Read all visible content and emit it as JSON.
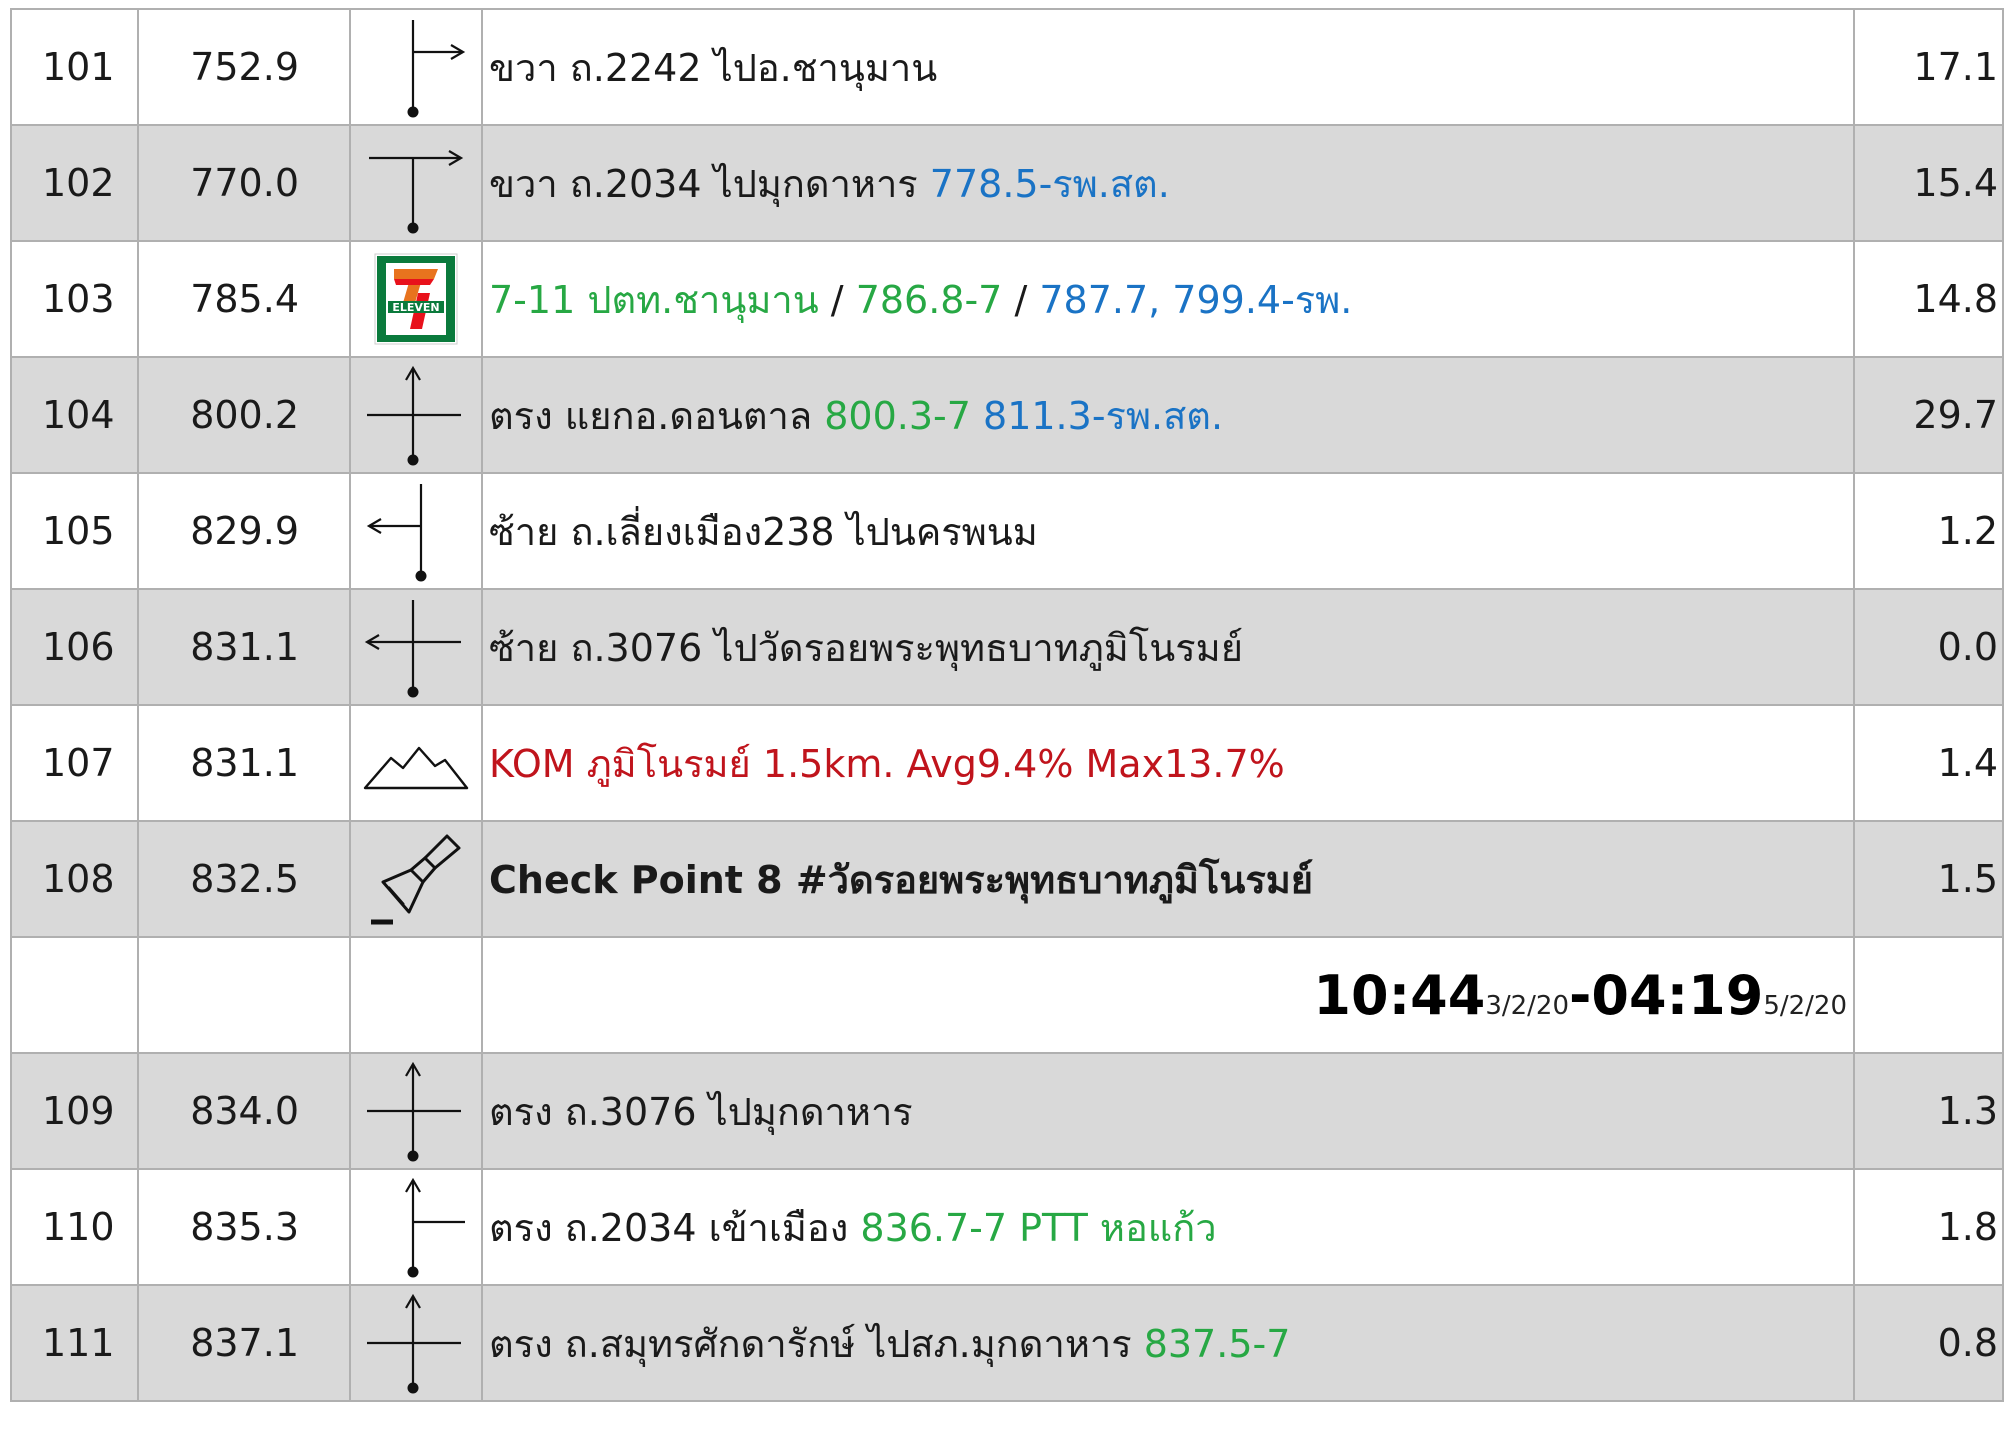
{
  "rows": [
    {
      "no": "101",
      "km": "752.9",
      "icon": "turn-right-icon",
      "segments": [
        {
          "t": "ขวา ถ.2242 ไปอ.ชานุมาน",
          "c": ""
        }
      ],
      "dist": "17.1",
      "gray": false
    },
    {
      "no": "102",
      "km": "770.0",
      "icon": "t-junction-right-icon",
      "segments": [
        {
          "t": "ขวา ถ.2034 ไปมุกดาหาร ",
          "c": ""
        },
        {
          "t": "778.5-รพ.สต.",
          "c": "blue"
        }
      ],
      "dist": "15.4",
      "gray": true
    },
    {
      "no": "103",
      "km": "785.4",
      "icon": "seven-eleven-logo",
      "segments": [
        {
          "t": "7-11 ปตท.ชานุมาน",
          "c": "green"
        },
        {
          "t": " / ",
          "c": ""
        },
        {
          "t": "786.8-7",
          "c": "green"
        },
        {
          "t": " / ",
          "c": ""
        },
        {
          "t": "787.7, 799.4-รพ.",
          "c": "blue"
        }
      ],
      "dist": "14.8",
      "gray": false
    },
    {
      "no": "104",
      "km": "800.2",
      "icon": "crossroad-straight-icon",
      "segments": [
        {
          "t": "ตรง แยกอ.ดอนตาล ",
          "c": ""
        },
        {
          "t": "800.3-7",
          "c": "green"
        },
        {
          "t": " ",
          "c": ""
        },
        {
          "t": "811.3-รพ.สต.",
          "c": "blue"
        }
      ],
      "dist": "29.7",
      "gray": true
    },
    {
      "no": "105",
      "km": "829.9",
      "icon": "turn-left-icon",
      "segments": [
        {
          "t": "ซ้าย ถ.เลี่ยงเมือง238 ไปนครพนม",
          "c": ""
        }
      ],
      "dist": "1.2",
      "gray": false
    },
    {
      "no": "106",
      "km": "831.1",
      "icon": "crossroad-left-icon",
      "segments": [
        {
          "t": "ซ้าย ถ.3076 ไปวัดรอยพระพุทธบาทภูมิโนรมย์",
          "c": ""
        }
      ],
      "dist": "0.0",
      "gray": true
    },
    {
      "no": "107",
      "km": "831.1",
      "icon": "mountain-icon",
      "segments": [
        {
          "t": "KOM ภูมิโนรมย์ 1.5km. Avg9.4% Max13.7%",
          "c": "red"
        }
      ],
      "dist": "1.4",
      "gray": false
    },
    {
      "no": "108",
      "km": "832.5",
      "icon": "stamp-icon",
      "segments": [
        {
          "t": "Check Point 8 #วัดรอยพระพุทธบาทภูมิโนรมย์",
          "c": "bold"
        }
      ],
      "dist": "1.5",
      "gray": true
    },
    {
      "no": "",
      "km": "",
      "icon": "",
      "time": {
        "open": "10:44",
        "open_date": "3/2/20",
        "close": "04:19",
        "close_date": "5/2/20"
      },
      "dist": "",
      "gray": false
    },
    {
      "no": "109",
      "km": "834.0",
      "icon": "crossroad-straight-icon",
      "segments": [
        {
          "t": "ตรง ถ.3076 ไปมุกดาหาร",
          "c": ""
        }
      ],
      "dist": "1.3",
      "gray": true
    },
    {
      "no": "110",
      "km": "835.3",
      "icon": "fork-straight-right-icon",
      "segments": [
        {
          "t": "ตรง ถ.2034 เข้าเมือง ",
          "c": ""
        },
        {
          "t": "836.7-7 PTT หอแก้ว",
          "c": "green"
        }
      ],
      "dist": "1.8",
      "gray": false
    },
    {
      "no": "111",
      "km": "837.1",
      "icon": "crossroad-straight-icon",
      "segments": [
        {
          "t": "ตรง ถ.สมุทรศักดารักษ์ ไปสภ.มุกดาหาร ",
          "c": ""
        },
        {
          "t": "837.5-7",
          "c": "green"
        }
      ],
      "dist": "0.8",
      "gray": true
    }
  ],
  "logo_text": "ELEVEN",
  "colors": {
    "row_gray": "#d9d9d9",
    "green": "#27a844",
    "blue": "#1a73c5",
    "red": "#c0141c",
    "grid": "#b0b0b0"
  }
}
